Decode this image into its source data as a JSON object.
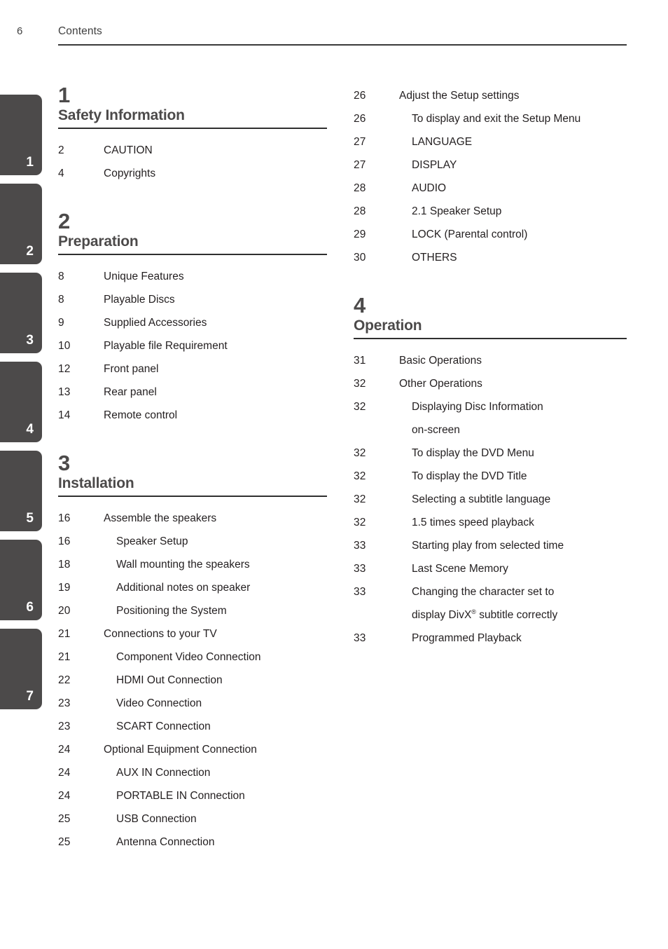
{
  "header": {
    "folio": "6",
    "title": "Contents"
  },
  "colors": {
    "tab": "#4c4a4a",
    "heading": "#4c4a4a",
    "text": "#231f20",
    "rule": "#2f2f2f"
  },
  "side_tabs": [
    {
      "label": "1"
    },
    {
      "label": "2"
    },
    {
      "label": "3"
    },
    {
      "label": "4"
    },
    {
      "label": "5"
    },
    {
      "label": "6"
    },
    {
      "label": "7"
    }
  ],
  "columns": {
    "left": [
      {
        "number": "1",
        "title": "Safety Information",
        "entries": [
          {
            "page": "2",
            "label": "CAUTION",
            "level": 1
          },
          {
            "page": "4",
            "label": "Copyrights",
            "level": 1
          }
        ]
      },
      {
        "number": "2",
        "title": "Preparation",
        "entries": [
          {
            "page": "8",
            "label": "Unique Features",
            "level": 1
          },
          {
            "page": "8",
            "label": "Playable Discs",
            "level": 1
          },
          {
            "page": "9",
            "label": "Supplied Accessories",
            "level": 1
          },
          {
            "page": "10",
            "label": "Playable file Requirement",
            "level": 1
          },
          {
            "page": "12",
            "label": "Front panel",
            "level": 1
          },
          {
            "page": "13",
            "label": "Rear panel",
            "level": 1
          },
          {
            "page": "14",
            "label": "Remote control",
            "level": 1
          }
        ]
      },
      {
        "number": "3",
        "title": "Installation",
        "entries": [
          {
            "page": "16",
            "label": "Assemble the speakers",
            "level": 1
          },
          {
            "page": "16",
            "label": "Speaker Setup",
            "level": 2
          },
          {
            "page": "18",
            "label": "Wall mounting the speakers",
            "level": 2
          },
          {
            "page": "19",
            "label": "Additional notes on speaker",
            "level": 2
          },
          {
            "page": "20",
            "label": "Positioning the System",
            "level": 2
          },
          {
            "page": "21",
            "label": "Connections to your TV",
            "level": 1
          },
          {
            "page": "21",
            "label": "Component Video Connection",
            "level": 2
          },
          {
            "page": "22",
            "label": "HDMI Out Connection",
            "level": 2
          },
          {
            "page": "23",
            "label": "Video Connection",
            "level": 2
          },
          {
            "page": "23",
            "label": "SCART Connection",
            "level": 2
          },
          {
            "page": "24",
            "label": "Optional Equipment Connection",
            "level": 1
          },
          {
            "page": "24",
            "label": "AUX IN Connection",
            "level": 2
          },
          {
            "page": "24",
            "label": "PORTABLE IN Connection",
            "level": 2
          },
          {
            "page": "25",
            "label": "USB Connection",
            "level": 2
          },
          {
            "page": "25",
            "label": "Antenna Connection",
            "level": 2
          }
        ]
      }
    ],
    "right": [
      {
        "number": "",
        "title": "",
        "entries": [
          {
            "page": "26",
            "label": "Adjust the Setup settings",
            "level": 1
          },
          {
            "page": "26",
            "label": "To display and exit the Setup Menu",
            "level": 2
          },
          {
            "page": "27",
            "label": "LANGUAGE",
            "level": 2
          },
          {
            "page": "27",
            "label": "DISPLAY",
            "level": 2
          },
          {
            "page": "28",
            "label": "AUDIO",
            "level": 2
          },
          {
            "page": "28",
            "label": "2.1 Speaker Setup",
            "level": 2
          },
          {
            "page": "29",
            "label": "LOCK (Parental control)",
            "level": 2
          },
          {
            "page": "30",
            "label": "OTHERS",
            "level": 2
          }
        ]
      },
      {
        "number": "4",
        "title": "Operation",
        "entries": [
          {
            "page": "31",
            "label": "Basic Operations",
            "level": 1
          },
          {
            "page": "32",
            "label": "Other Operations",
            "level": 1
          },
          {
            "page": "32",
            "label": "Displaying Disc Information",
            "label2": "on-screen",
            "level": 2
          },
          {
            "page": "32",
            "label": "To display the DVD Menu",
            "level": 2
          },
          {
            "page": "32",
            "label": "To display the DVD Title",
            "level": 2
          },
          {
            "page": "32",
            "label": "Selecting a subtitle language",
            "level": 2
          },
          {
            "page": "32",
            "label": "1.5 times speed playback",
            "level": 2
          },
          {
            "page": "33",
            "label": "Starting play from selected time",
            "level": 2
          },
          {
            "page": "33",
            "label": "Last Scene Memory",
            "level": 2
          },
          {
            "page": "33",
            "label": "Changing the character set to",
            "label2": "display DivX® subtitle correctly",
            "level": 2
          },
          {
            "page": "33",
            "label": "Programmed Playback",
            "level": 2
          }
        ]
      }
    ]
  }
}
